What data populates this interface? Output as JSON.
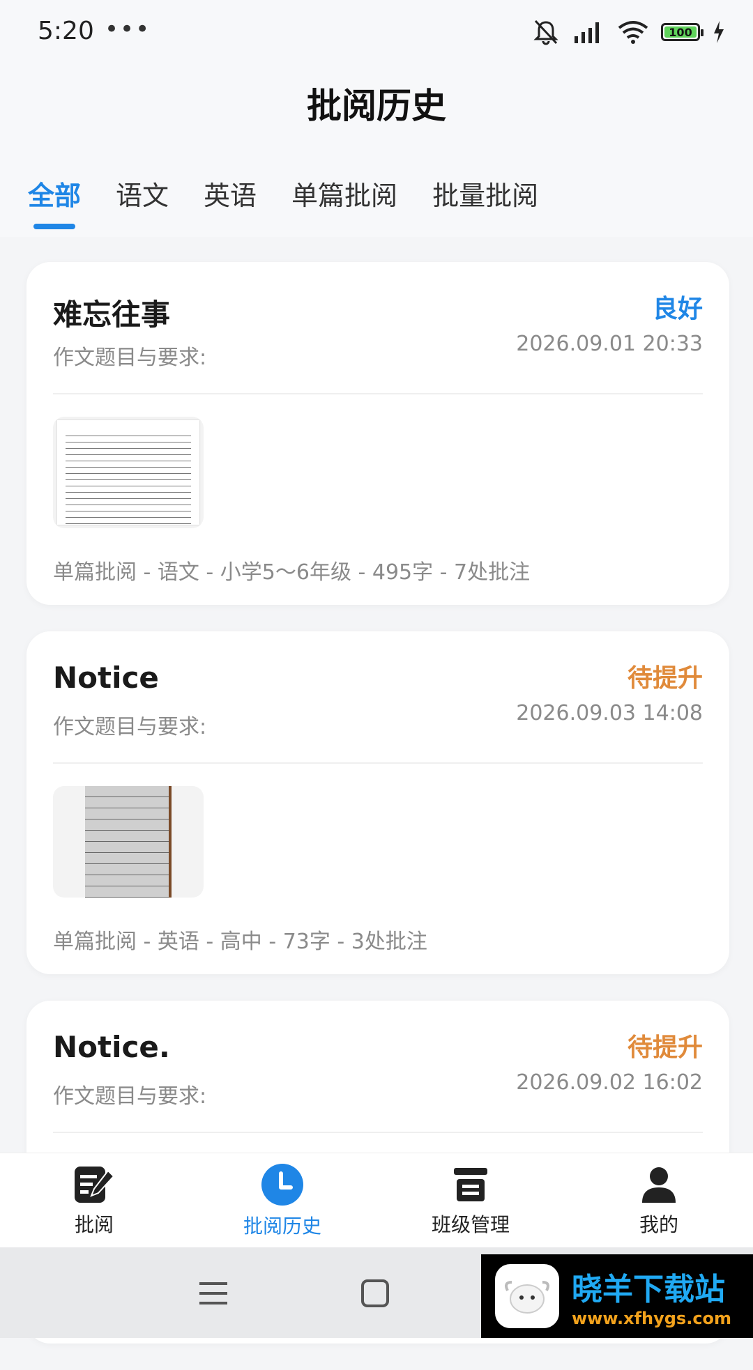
{
  "status_bar": {
    "time": "5:20",
    "dots": "•••",
    "battery": "100"
  },
  "header": {
    "title": "批阅历史"
  },
  "tabs": [
    {
      "label": "全部",
      "active": true
    },
    {
      "label": "语文"
    },
    {
      "label": "英语"
    },
    {
      "label": "单篇批阅"
    },
    {
      "label": "批量批阅"
    }
  ],
  "cards": [
    {
      "title": "难忘往事",
      "grade": "良好",
      "grade_color": "#1f86e6",
      "requirement": "作文题目与要求:",
      "date": "2026.09.01 20:33",
      "meta": "单篇批阅 - 语文 - 小学5～6年级 - 495字 - 7处批注"
    },
    {
      "title": "Notice",
      "grade": "待提升",
      "grade_color": "#e08a3a",
      "requirement": "作文题目与要求:",
      "date": "2026.09.03 14:08",
      "meta": "单篇批阅 - 英语 - 高中 - 73字 - 3处批注"
    },
    {
      "title": "Notice.",
      "grade": "待提升",
      "grade_color": "#e08a3a",
      "requirement": "作文题目与要求:",
      "date": "2026.09.02 16:02"
    }
  ],
  "bottom_nav": [
    {
      "label": "批阅",
      "icon": "edit-document-icon"
    },
    {
      "label": "批阅历史",
      "icon": "clock-icon",
      "active": true
    },
    {
      "label": "班级管理",
      "icon": "class-icon"
    },
    {
      "label": "我的",
      "icon": "user-icon"
    }
  ],
  "watermark": {
    "title": "晓羊下载站",
    "url": "www.xfhygs.com"
  }
}
